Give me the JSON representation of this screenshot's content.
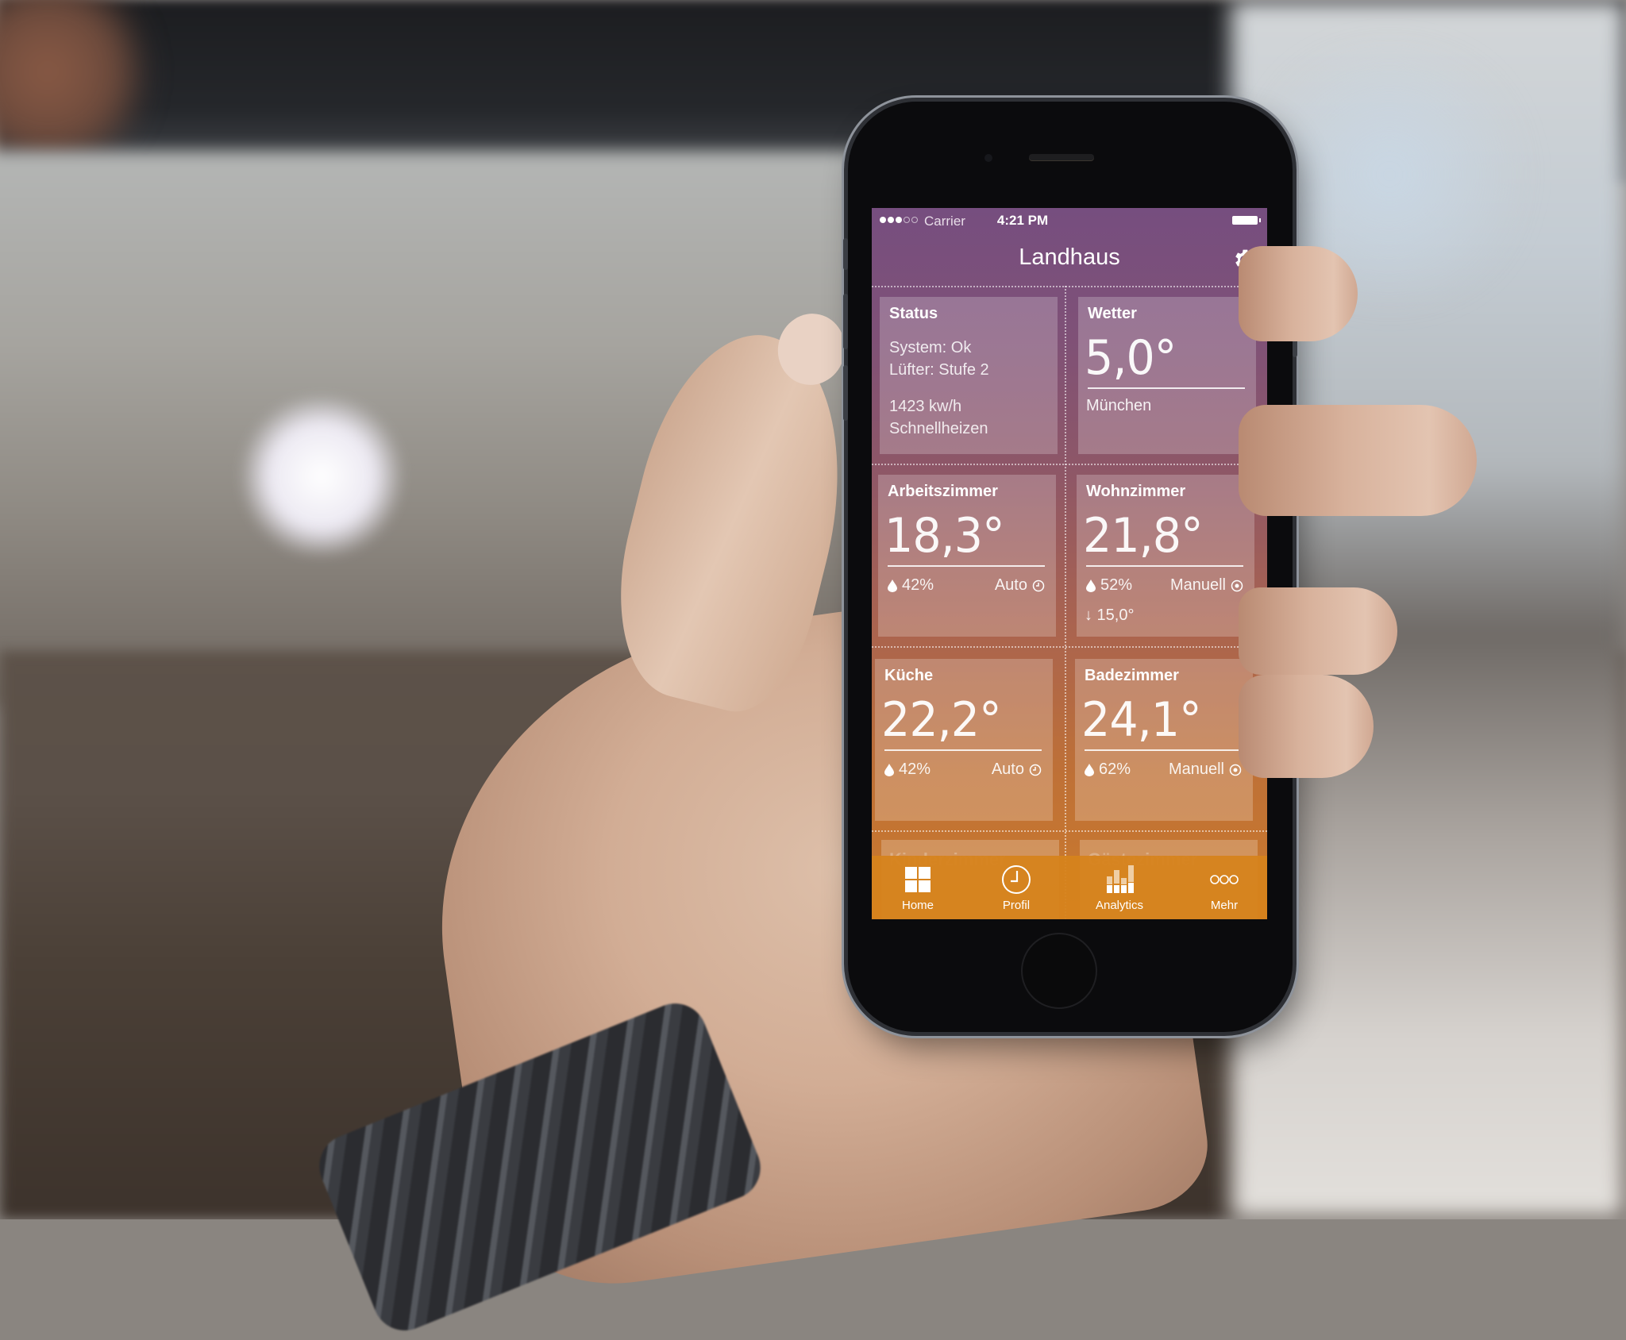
{
  "status_bar": {
    "carrier": "Carrier",
    "time": "4:21 PM",
    "signal_bars_filled": 3,
    "signal_bars_total": 5
  },
  "nav": {
    "title": "Landhaus",
    "settings_icon": "gear-icon"
  },
  "tiles": {
    "status": {
      "title": "Status",
      "lines": [
        "System: Ok",
        "Lüfter: Stufe 2"
      ],
      "energy": "1423 kw/h",
      "mode": "Schnellheizen"
    },
    "weather": {
      "title": "Wetter",
      "temp": "5,0°",
      "city": "München"
    },
    "rooms": [
      {
        "name": "Arbeitszimmer",
        "temp": "18,3°",
        "humidity": "42%",
        "mode": "Auto",
        "mode_icon": "clock-icon"
      },
      {
        "name": "Wohnzimmer",
        "temp": "21,8°",
        "humidity": "52%",
        "mode": "Manuell",
        "mode_icon": "target-icon",
        "setpoint": "↓ 15,0°"
      },
      {
        "name": "Küche",
        "temp": "22,2°",
        "humidity": "42%",
        "mode": "Auto",
        "mode_icon": "clock-icon"
      },
      {
        "name": "Badezimmer",
        "temp": "24,1°",
        "humidity": "62%",
        "mode": "Manuell",
        "mode_icon": "target-icon"
      },
      {
        "name": "Kinderzimmer"
      },
      {
        "name": "Gästezimmer"
      }
    ]
  },
  "tabbar": {
    "items": [
      {
        "label": "Home",
        "icon": "grid-icon",
        "active": true
      },
      {
        "label": "Profil",
        "icon": "clock-icon"
      },
      {
        "label": "Analytics",
        "icon": "bar-chart-icon"
      },
      {
        "label": "Mehr",
        "icon": "more-icon"
      }
    ]
  },
  "colors": {
    "header_purple": "#764e7f",
    "bottom_orange": "#cb7a2c",
    "tabbar_orange": "#d6831c"
  }
}
